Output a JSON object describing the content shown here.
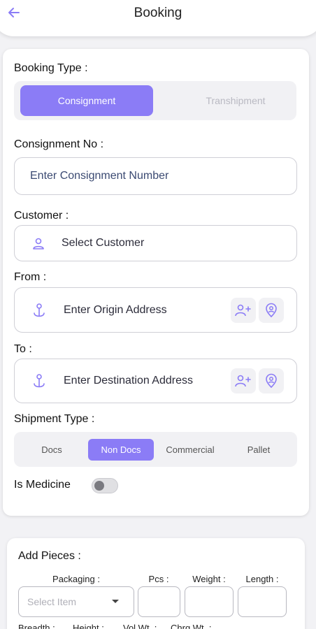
{
  "header": {
    "title": "Booking",
    "back_icon": "arrow-left-icon"
  },
  "colors": {
    "accent": "#8b7cf6",
    "background": "#f2f2f5",
    "icon": "#8b7cf6"
  },
  "booking_type": {
    "label": "Booking Type :",
    "options": [
      "Consignment",
      "Transhipment"
    ],
    "selected": "Consignment"
  },
  "consignment": {
    "label": "Consignment No :",
    "placeholder": "Enter Consignment Number"
  },
  "customer": {
    "label": "Customer :",
    "placeholder": "Select Customer",
    "icon": "user-icon"
  },
  "from": {
    "label": "From :",
    "placeholder": "Enter Origin Address",
    "icon": "anchor-pin-icon",
    "actions": [
      "add-user-icon",
      "location-pin-icon"
    ]
  },
  "to": {
    "label": "To :",
    "placeholder": "Enter Destination Address",
    "icon": "anchor-pin-icon",
    "actions": [
      "add-user-icon",
      "location-pin-icon"
    ]
  },
  "shipment_type": {
    "label": "Shipment Type :",
    "options": [
      "Docs",
      "Non Docs",
      "Commercial",
      "Pallet"
    ],
    "selected": "Non Docs"
  },
  "medicine": {
    "label": "Is Medicine",
    "enabled": false
  },
  "pieces": {
    "title": "Add Pieces :",
    "packaging_label": "Packaging :",
    "packaging_placeholder": "Select Item",
    "pcs_label": "Pcs :",
    "weight_label": "Weight :",
    "length_label": "Length :",
    "breadth_label": "Breadth :",
    "height_label": "Height :",
    "volwt_label": "Vol.Wt. :",
    "chrgwt_label": "Chrg.Wt. :"
  }
}
